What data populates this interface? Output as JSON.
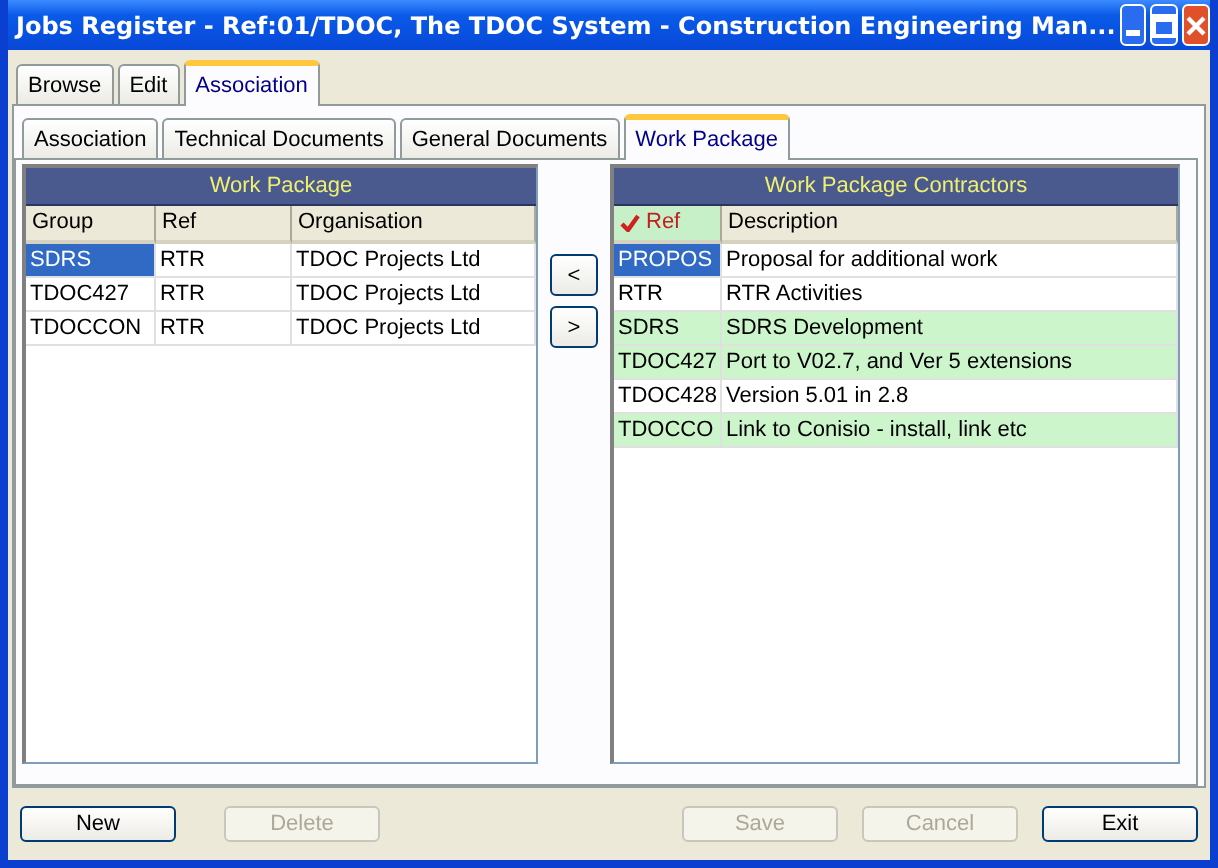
{
  "window": {
    "title": "Jobs Register - Ref:01/TDOC, The TDOC System - Construction Engineering Man..."
  },
  "tabs": [
    {
      "label": "Browse",
      "selected": false
    },
    {
      "label": "Edit",
      "selected": false
    },
    {
      "label": "Association",
      "selected": true
    }
  ],
  "subtabs": [
    {
      "label": "Association",
      "selected": false
    },
    {
      "label": "Technical Documents",
      "selected": false
    },
    {
      "label": "General Documents",
      "selected": false
    },
    {
      "label": "Work Package",
      "selected": true
    }
  ],
  "work_package": {
    "title": "Work Package",
    "columns": [
      {
        "label": "Group",
        "sorted": false
      },
      {
        "label": "Ref",
        "sorted": false
      },
      {
        "label": "Organisation",
        "sorted": false
      }
    ],
    "rows": [
      {
        "cells": [
          "SDRS",
          "RTR",
          "TDOC Projects Ltd"
        ],
        "selected": true,
        "highlighted": false
      },
      {
        "cells": [
          "TDOC427",
          "RTR",
          "TDOC Projects Ltd"
        ],
        "selected": false,
        "highlighted": false
      },
      {
        "cells": [
          "TDOCCON",
          "RTR",
          "TDOC Projects Ltd"
        ],
        "selected": false,
        "highlighted": false
      }
    ]
  },
  "move_buttons": [
    "<",
    ">"
  ],
  "contractors": {
    "title": "Work Package Contractors",
    "columns": [
      {
        "label": "Ref",
        "sorted": true
      },
      {
        "label": "Description",
        "sorted": false
      }
    ],
    "rows": [
      {
        "cells": [
          "PROPOS",
          "Proposal for additional work"
        ],
        "selected": true,
        "highlighted": false
      },
      {
        "cells": [
          "RTR",
          "RTR Activities"
        ],
        "selected": false,
        "highlighted": false
      },
      {
        "cells": [
          "SDRS",
          "SDRS Development"
        ],
        "selected": false,
        "highlighted": true
      },
      {
        "cells": [
          "TDOC427",
          "Port to V02.7, and Ver 5 extensions"
        ],
        "selected": false,
        "highlighted": true
      },
      {
        "cells": [
          "TDOC428",
          "Version 5.01 in 2.8"
        ],
        "selected": false,
        "highlighted": false
      },
      {
        "cells": [
          "TDOCCO",
          "Link to Conisio - install, link etc"
        ],
        "selected": false,
        "highlighted": true
      }
    ]
  },
  "buttons": [
    {
      "label": "New",
      "disabled": false
    },
    {
      "label": "Delete",
      "disabled": true
    },
    {
      "label": "Save",
      "disabled": true
    },
    {
      "label": "Cancel",
      "disabled": true
    },
    {
      "label": "Exit",
      "disabled": false
    }
  ]
}
